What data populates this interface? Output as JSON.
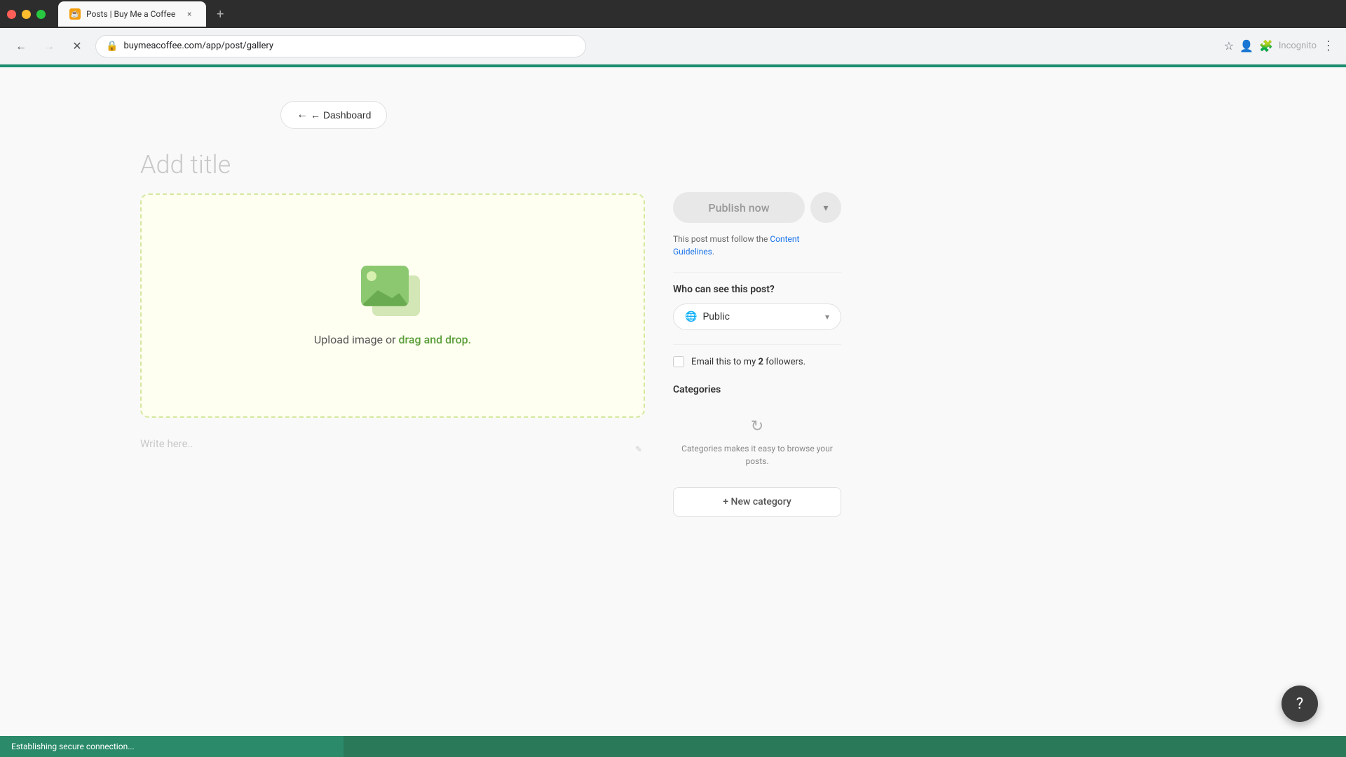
{
  "browser": {
    "tab_title": "Posts | Buy Me a Coffee",
    "tab_favicon": "☕",
    "tab_close_label": "×",
    "new_tab_label": "+",
    "address": "buymeacoffee.com/app/post/gallery",
    "back_label": "←",
    "forward_label": "→",
    "reload_label": "✕",
    "toolbar_right_label": "Incognito"
  },
  "back_button": {
    "label": "← Dashboard"
  },
  "editor": {
    "title_placeholder": "Add title",
    "upload_text": "Upload image or ",
    "upload_link": "drag and drop.",
    "write_placeholder": "Write here.."
  },
  "sidebar": {
    "publish_btn": "Publish now",
    "chevron_label": "▾",
    "guidelines_text": "This post must follow the ",
    "guidelines_link": "Content Guidelines",
    "guidelines_end": ".",
    "visibility_label": "Who can see this post?",
    "visibility_option": "Public",
    "email_label_prefix": "Email this to my ",
    "email_followers_count": "2",
    "email_label_suffix": " followers.",
    "categories_label": "Categories",
    "categories_empty_text": "Categories makes it easy to browse your posts.",
    "new_category_btn": "+ New category"
  },
  "status_bar": {
    "text": "Establishing secure connection..."
  },
  "help_btn": "?"
}
